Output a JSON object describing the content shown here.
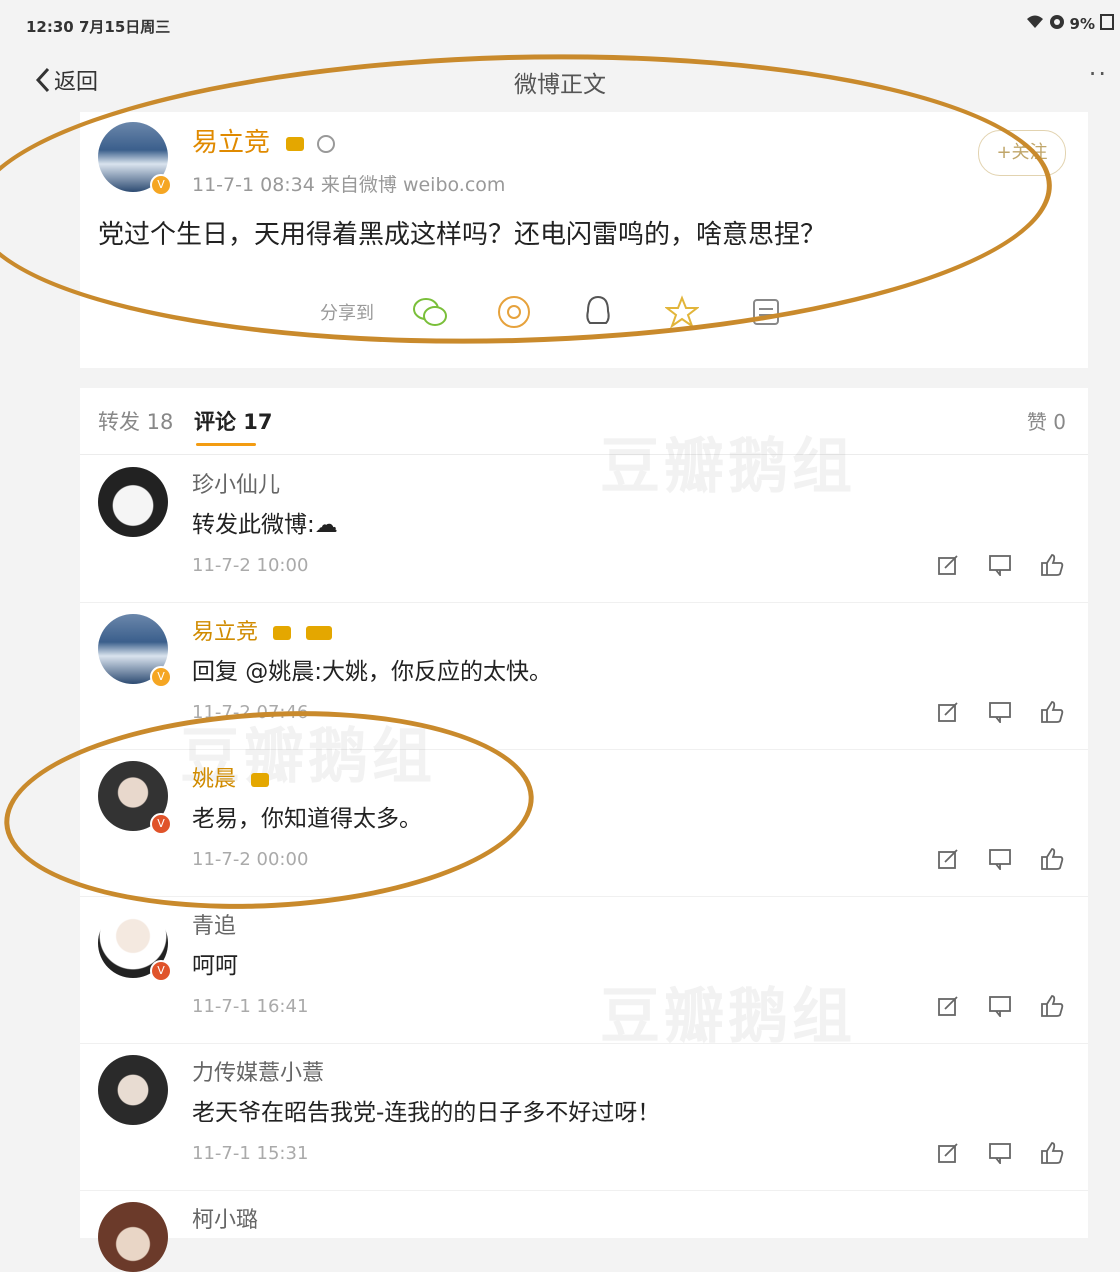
{
  "status_bar": {
    "time": "12:30  7月15日周三",
    "battery": "9%"
  },
  "nav": {
    "back_label": "返回",
    "title": "微博正文",
    "more": "··"
  },
  "post": {
    "author": "易立竞",
    "meta": "11-7-1 08:34  来自微博 weibo.com",
    "content": "党过个生日，天用得着黑成这样吗？还电闪雷鸣的，啥意思捏？",
    "follow_label": "+关注",
    "share_label": "分享到",
    "share_targets": [
      "wechat-icon",
      "moments-icon",
      "qq-icon",
      "qzone-icon",
      "more-share-icon"
    ]
  },
  "tabs": {
    "repost": "转发 18",
    "comment": "评论 17",
    "likes": "赞 0"
  },
  "comments": [
    {
      "name": "珍小仙儿",
      "text": "转发此微博:☁",
      "time": "11-7-2 10:00"
    },
    {
      "name": "易立竞",
      "text": "回复 @姚晨:大姚，你反应的太快。",
      "time": "11-7-2 07:46"
    },
    {
      "name": "姚晨",
      "text": "老易，你知道得太多。",
      "time": "11-7-2 00:00"
    },
    {
      "name": "青追",
      "text": "呵呵",
      "time": "11-7-1 16:41"
    },
    {
      "name": "力传媒薏小薏",
      "text": "老天爷在昭告我党-连我的的日子多不好过呀！",
      "time": "11-7-1 15:31"
    },
    {
      "name": "柯小璐",
      "text": "",
      "time": ""
    }
  ],
  "watermark": "豆瓣鹅组",
  "colors": {
    "annotation_circle": "#c98a2c",
    "vip_name": "#d08b00",
    "tab_underline": "#f39c12"
  }
}
